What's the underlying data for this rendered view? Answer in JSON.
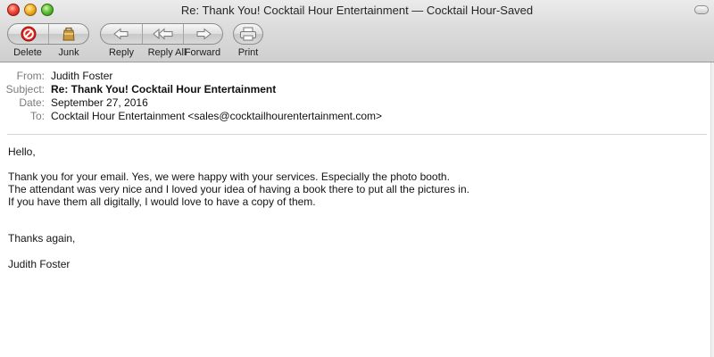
{
  "window": {
    "title": "Re: Thank You! Cocktail Hour Entertainment — Cocktail Hour-Saved"
  },
  "toolbar": {
    "delete_label": "Delete",
    "junk_label": "Junk",
    "reply_label": "Reply",
    "reply_all_label": "Reply All",
    "forward_label": "Forward",
    "print_label": "Print"
  },
  "icons": {
    "delete": "no-entry-icon",
    "junk": "junk-bag-icon",
    "reply": "reply-arrow-icon",
    "reply_all": "reply-all-arrow-icon",
    "forward": "forward-arrow-icon",
    "print": "printer-icon"
  },
  "colors": {
    "delete_red": "#e0261c",
    "junk_brown": "#b98a2f",
    "label_gray": "#7b7b7b"
  },
  "headers": {
    "from_label": "From:",
    "from_value": "Judith Foster",
    "subject_label": "Subject:",
    "subject_value": "Re: Thank You! Cocktail Hour Entertainment",
    "date_label": "Date:",
    "date_value": "September 27, 2016",
    "to_label": "To:",
    "to_value": "Cocktail Hour Entertainment <sales@cocktailhourentertainment.com>"
  },
  "body": {
    "greeting": "Hello,",
    "lines": [
      "Thank you for your email. Yes, we were happy with your services. Especially the photo booth.",
      "The attendant was very nice and I loved your idea of having a book there to put all the pictures in.",
      "If you have them all digitally, I would love to have a copy of them."
    ],
    "closing": "Thanks again,",
    "signature": "Judith Foster"
  }
}
